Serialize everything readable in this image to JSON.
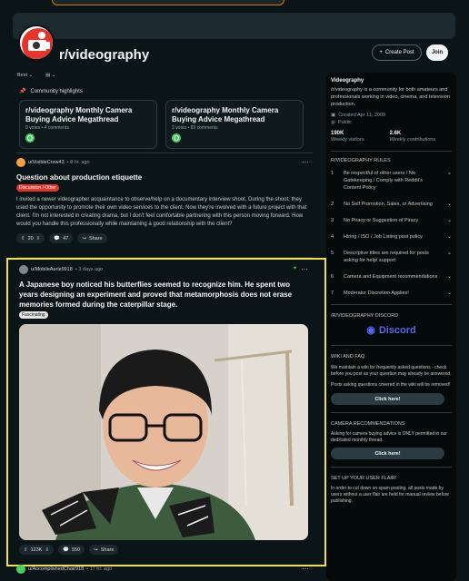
{
  "subreddit": {
    "name": "r/videography"
  },
  "header": {
    "create_post": "Create Post",
    "join": "Join"
  },
  "sort": {
    "label": "Best"
  },
  "highlights": {
    "heading": "Community highlights",
    "cards": [
      {
        "title": "r/videography Monthly Camera Buying Advice Megathread",
        "meta": "0 votes • 4 comments"
      },
      {
        "title": "r/videography Monthly Camera Buying Advice Megathread",
        "meta": "3 votes • 89 comments"
      }
    ]
  },
  "posts": [
    {
      "user": "u/VisibleCrew43",
      "time": "• 8 hr. ago",
      "title": "Question about production etiquette",
      "flair": "Discussion / Other",
      "body": "I invited a newer videographer acquaintance to observe/help on a documentary interview shoot. During the shoot, they used the opportunity to promote their own video services to the client. Now they're involved with a future project with that client. I'm not interested in creating drama, but I don't feel comfortable partnering with this person moving forward. How would you handle this professionally while maintaining a good relationship with the client?",
      "votes": "20",
      "comments": "47",
      "share": "Share"
    },
    {
      "user": "u/MobileAerie9918",
      "time": "• 3 days ago",
      "title": "A Japanese boy noticed his butterflies seemed to recognize him. He spent two years designing an experiment and proved that metamorphosis does not erase memories formed during the caterpillar stage.",
      "flair": "Fascinating",
      "votes": "123K",
      "comments": "550",
      "share": "Share"
    },
    {
      "user": "u/AccomplishedChair918",
      "time": "• 17 hr. ago"
    }
  ],
  "sidebar": {
    "name": "Videography",
    "description": "/r/videography is a community for both amateurs and professionals working in video, cinema, and television production.",
    "created": "Created Apr 11, 2009",
    "visibility": "Public",
    "visitors": "190K",
    "visitors_label": "Weekly visitors",
    "contributions": "2.6K",
    "contributions_label": "Weekly contributions",
    "rules_heading": "R/VIDEOGRAPHY RULES",
    "rules": [
      {
        "n": "1",
        "text": "Be respectful of other users / No Gatekeeping / Comply with Reddit's Content Policy"
      },
      {
        "n": "2",
        "text": "No Self Promotion, Sales, or Advertising"
      },
      {
        "n": "3",
        "text": "No Piracy or Suggestion of Piracy"
      },
      {
        "n": "4",
        "text": "Hiring / ISO / Job Listing post policy"
      },
      {
        "n": "5",
        "text": "Descriptive titles are required for posts asking for help/ support"
      },
      {
        "n": "6",
        "text": "Camera and Equipment recommendations"
      },
      {
        "n": "7",
        "text": "Moderator Discretion Applies!"
      }
    ],
    "discord_heading": "/R/VIDEOGRAPHY DISCORD",
    "discord_label": "Discord",
    "wiki_heading": "WIKI AND FAQ",
    "wiki_text1": "We maintain a wiki for frequently asked questions - check before you post as your question may already be answered.",
    "wiki_text2": "Posts asking questions covered in the wiki will be removed!",
    "click_here": "Click here!",
    "camera_heading": "CAMERA RECOMMENDATIONS",
    "camera_text": "Asking for camera buying advice is ONLY permitted in our dedicated monthly thread.",
    "flair_heading": "SET UP YOUR USER FLAIR!",
    "flair_text": "In order to cut down on spam posting, all posts made by users without a user flair are held for manual review before publishing."
  },
  "colors": {
    "background": "#0b1416",
    "highlight_border": "#f3e047",
    "flair_red": "#e0352b",
    "accent_blue": "#5865f2"
  }
}
